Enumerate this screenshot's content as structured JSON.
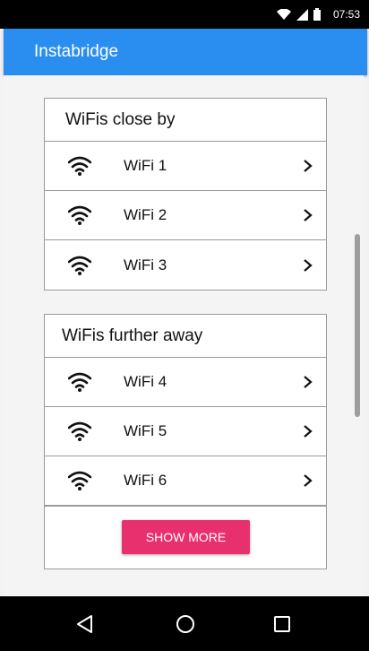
{
  "status_bar": {
    "time": "07:53",
    "icons": [
      "wifi-icon",
      "signal-icon",
      "battery-icon"
    ]
  },
  "app_bar": {
    "title": "Instabridge",
    "color": "#2a8ef1"
  },
  "sections": [
    {
      "title": "WiFis close by",
      "items": [
        {
          "label": "WiFi 1",
          "icon": "wifi-icon"
        },
        {
          "label": "WiFi 2",
          "icon": "wifi-icon"
        },
        {
          "label": "WiFi 3",
          "icon": "wifi-icon"
        }
      ]
    },
    {
      "title": "WiFis further away",
      "items": [
        {
          "label": "WiFi 4",
          "icon": "wifi-icon"
        },
        {
          "label": "WiFi 5",
          "icon": "wifi-icon"
        },
        {
          "label": "WiFi 6",
          "icon": "wifi-icon"
        }
      ]
    }
  ],
  "show_more": {
    "label": "SHOW MORE",
    "color": "#e8306e"
  },
  "nav_bar": {
    "buttons": [
      "back-icon",
      "home-icon",
      "recents-icon"
    ]
  }
}
